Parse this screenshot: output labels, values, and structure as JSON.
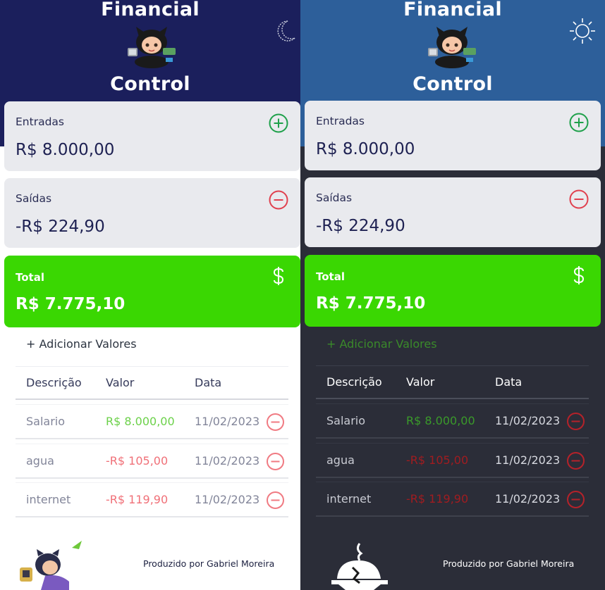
{
  "app": {
    "title_line1": "Financial",
    "title_line2": "Control"
  },
  "summary": {
    "income_label": "Entradas",
    "income_value": "R$ 8.000,00",
    "expense_label": "Saídas",
    "expense_value": "-R$ 224,90",
    "total_label": "Total",
    "total_value": "R$ 7.775,10"
  },
  "actions": {
    "add_values": "+ Adicionar Valores"
  },
  "table": {
    "headers": [
      "Descrição",
      "Valor",
      "Data"
    ],
    "rows": [
      {
        "description": "Salario",
        "value": "R$ 8.000,00",
        "date": "11/02/2023",
        "type": "income"
      },
      {
        "description": "agua",
        "value": "-R$ 105,00",
        "date": "11/02/2023",
        "type": "expense"
      },
      {
        "description": "internet",
        "value": "-R$ 119,90",
        "date": "11/02/2023",
        "type": "expense"
      }
    ]
  },
  "footer": {
    "credit": "Produzido por Gabriel Moreira"
  },
  "themes": {
    "light": {
      "header_bg": "#1b1f5c",
      "toggle_icon": "moon-icon"
    },
    "dark": {
      "header_bg": "#2d5f9a",
      "toggle_icon": "sun-icon"
    }
  },
  "colors": {
    "income_icon": "#1ea04a",
    "expense_icon": "#e0404e",
    "total_bg": "#3ad702"
  }
}
